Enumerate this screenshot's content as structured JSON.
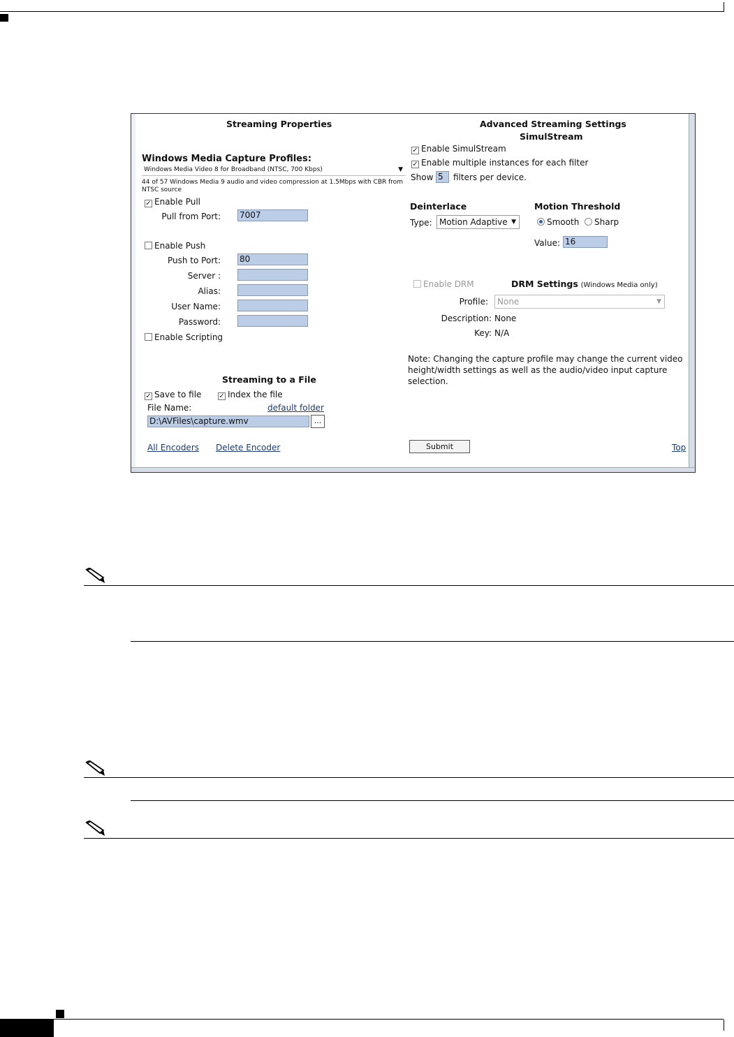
{
  "form": {
    "left_title": "Streaming Properties",
    "profiles_label": "Windows Media Capture Profiles:",
    "profile_value": "Windows Media Video 8 for Broadband (NTSC, 700 Kbps)",
    "profile_desc_1": "44 of 57 Windows Media 9 audio and video compression at 1.5Mbps with CBR from",
    "profile_desc_2": "NTSC source",
    "enable_pull": "Enable Pull",
    "pull_port_label": "Pull from Port:",
    "pull_port_value": "7007",
    "enable_push": "Enable Push",
    "push_port_label": "Push to Port:",
    "push_port_value": "80",
    "server_label": "Server :",
    "alias_label": "Alias:",
    "username_label": "User Name:",
    "password_label": "Password:",
    "enable_scripting": "Enable Scripting",
    "file_title": "Streaming to a File",
    "save_to_file": "Save to file",
    "index_file": "Index the file",
    "file_name_label": "File Name:",
    "default_folder": "default folder",
    "file_path": "D:\\AVFiles\\capture.wmv",
    "browse_label": "...",
    "all_encoders": "All Encoders",
    "delete_encoder": "Delete Encoder",
    "right_title": "Advanced Streaming Settings",
    "simulstream_title": "SimulStream",
    "enable_simulstream": "Enable SimulStream",
    "enable_multi": "Enable multiple instances for each filter",
    "show_label": "Show",
    "show_value": "5",
    "filters_per_device": "filters per device.",
    "deinterlace_title": "Deinterlace",
    "type_label": "Type:",
    "type_value": "Motion Adaptive",
    "motion_title": "Motion Threshold",
    "smooth": "Smooth",
    "sharp": "Sharp",
    "value_label": "Value:",
    "value_value": "16",
    "enable_drm": "Enable DRM",
    "drm_title": "DRM Settings",
    "drm_sub": "(Windows Media only)",
    "profile_label": "Profile:",
    "profile_drm_value": "None",
    "description_label": "Description:",
    "description_value": "None",
    "key_label": "Key:",
    "key_value": "N/A",
    "note_1": "Note: Changing the capture profile may change the current video",
    "note_2": "height/width settings as well as the audio/video input capture",
    "note_3": "selection.",
    "submit": "Submit",
    "top_link": "Top"
  },
  "check_mark": "✓"
}
